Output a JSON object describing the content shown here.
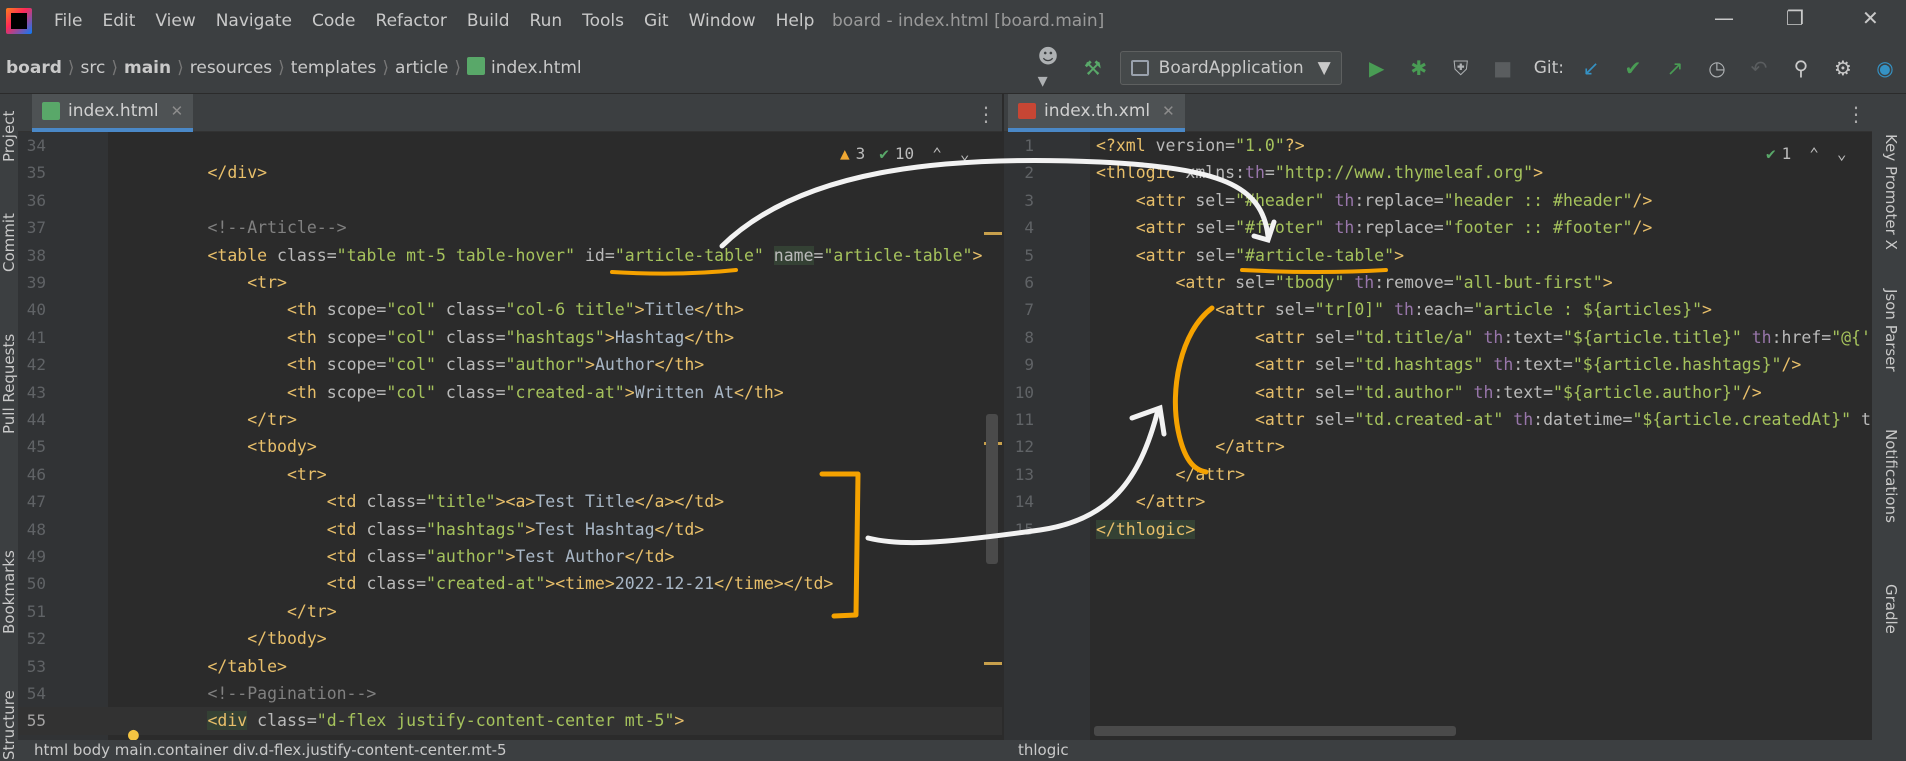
{
  "menu": {
    "items": [
      "File",
      "Edit",
      "View",
      "Navigate",
      "Code",
      "Refactor",
      "Build",
      "Run",
      "Tools",
      "Git",
      "Window",
      "Help"
    ],
    "window_title": "board - index.html [board.main]"
  },
  "breadcrumbs": [
    "board",
    "src",
    "main",
    "resources",
    "templates",
    "article",
    "index.html"
  ],
  "toolbar": {
    "run_config": "BoardApplication",
    "git_label": "Git:"
  },
  "side_tools": {
    "left": [
      "Project",
      "Commit",
      "Pull Requests",
      "Bookmarks",
      "Structure"
    ],
    "right": [
      "Key Promoter X",
      "Json Parser",
      "Notifications",
      "Gradle"
    ]
  },
  "left_editor": {
    "tab": "index.html",
    "warnings": "3",
    "checks": "10",
    "lines": [
      {
        "n": "34",
        "html": ""
      },
      {
        "n": "35",
        "html": "        <span class='t'>&lt;/div&gt;</span>"
      },
      {
        "n": "36",
        "html": ""
      },
      {
        "n": "37",
        "html": "        <span class='c'>&lt;!--Article--&gt;</span>"
      },
      {
        "n": "38",
        "html": "        <span class='t'>&lt;table </span><span class='a'>class=</span><span class='v'>\"table mt-5 table-hover\"</span><span class='a'> id=</span><span class='v'>\"article-table\"</span><span class='a'> <span class='hl'>name</span>=</span><span class='v'>\"article-table\"</span><span class='t'>&gt;</span>"
      },
      {
        "n": "39",
        "html": "            <span class='t'>&lt;tr&gt;</span>"
      },
      {
        "n": "40",
        "html": "                <span class='t'>&lt;th </span><span class='a'>scope=</span><span class='v'>\"col\"</span><span class='a'> class=</span><span class='v'>\"col-6 title\"</span><span class='t'>&gt;</span><span class='x'>Title</span><span class='t'>&lt;/th&gt;</span>"
      },
      {
        "n": "41",
        "html": "                <span class='t'>&lt;th </span><span class='a'>scope=</span><span class='v'>\"col\"</span><span class='a'> class=</span><span class='v'>\"hashtags\"</span><span class='t'>&gt;</span><span class='x'>Hashtag</span><span class='t'>&lt;/th&gt;</span>"
      },
      {
        "n": "42",
        "html": "                <span class='t'>&lt;th </span><span class='a'>scope=</span><span class='v'>\"col\"</span><span class='a'> class=</span><span class='v'>\"author\"</span><span class='t'>&gt;</span><span class='x'>Author</span><span class='t'>&lt;/th&gt;</span>"
      },
      {
        "n": "43",
        "html": "                <span class='t'>&lt;th </span><span class='a'>scope=</span><span class='v'>\"col\"</span><span class='a'> class=</span><span class='v'>\"created-at\"</span><span class='t'>&gt;</span><span class='x'>Written At</span><span class='t'>&lt;/th&gt;</span>"
      },
      {
        "n": "44",
        "html": "            <span class='t'>&lt;/tr&gt;</span>"
      },
      {
        "n": "45",
        "html": "            <span class='t'>&lt;tbody&gt;</span>"
      },
      {
        "n": "46",
        "html": "                <span class='t'>&lt;tr&gt;</span>"
      },
      {
        "n": "47",
        "html": "                    <span class='t'>&lt;td </span><span class='a'>class=</span><span class='v'>\"title\"</span><span class='t'>&gt;&lt;a&gt;</span><span class='x'>Test Title</span><span class='t'>&lt;/a&gt;&lt;/td&gt;</span>"
      },
      {
        "n": "48",
        "html": "                    <span class='t'>&lt;td </span><span class='a'>class=</span><span class='v'>\"hashtags\"</span><span class='t'>&gt;</span><span class='x'>Test Hashtag</span><span class='t'>&lt;/td&gt;</span>"
      },
      {
        "n": "49",
        "html": "                    <span class='t'>&lt;td </span><span class='a'>class=</span><span class='v'>\"author\"</span><span class='t'>&gt;</span><span class='x'>Test Author</span><span class='t'>&lt;/td&gt;</span>"
      },
      {
        "n": "50",
        "html": "                    <span class='t'>&lt;td </span><span class='a'>class=</span><span class='v'>\"created-at\"</span><span class='t'>&gt;&lt;time&gt;</span><span class='x'>2022-12-21</span><span class='t'>&lt;/time&gt;&lt;/td&gt;</span>"
      },
      {
        "n": "51",
        "html": "                <span class='t'>&lt;/tr&gt;</span>"
      },
      {
        "n": "52",
        "html": "            <span class='t'>&lt;/tbody&gt;</span>"
      },
      {
        "n": "53",
        "html": "        <span class='t'>&lt;/table&gt;</span>"
      },
      {
        "n": "54",
        "html": "        <span class='c'>&lt;!--Pagination--&gt;</span>"
      },
      {
        "n": "55",
        "html": "        <span class='t'><span class='hl'>&lt;div</span> </span><span class='a'>class=</span><span class='v'>\"d-flex justify-content-center mt-5\"</span><span class='t'>&gt;</span>"
      }
    ],
    "status_path": "html  body  main.container  div.d-flex.justify-content-center.mt-5"
  },
  "right_editor": {
    "tab": "index.th.xml",
    "checks": "1",
    "lines": [
      {
        "n": "1",
        "html": "<span class='t'>&lt;?xml </span><span class='a'>version=</span><span class='v'>\"1.0\"</span><span class='t'>?&gt;</span>"
      },
      {
        "n": "2",
        "html": "<span class='t'>&lt;thlogic </span><span class='a'>xmlns:</span><span class='n'>th</span><span class='a'>=</span><span class='v'>\"http://www.thymeleaf.org\"</span><span class='t'>&gt;</span>"
      },
      {
        "n": "3",
        "html": "    <span class='t'>&lt;attr </span><span class='a'>sel=</span><span class='v'>\"#header\"</span><span class='a'> </span><span class='n'>th</span><span class='a'>:replace=</span><span class='v'>\"header :: #header\"</span><span class='t'>/&gt;</span>"
      },
      {
        "n": "4",
        "html": "    <span class='t'>&lt;attr </span><span class='a'>sel=</span><span class='v'>\"#footer\"</span><span class='a'> </span><span class='n'>th</span><span class='a'>:replace=</span><span class='v'>\"footer :: #footer\"</span><span class='t'>/&gt;</span>"
      },
      {
        "n": "5",
        "html": "    <span class='t'>&lt;attr </span><span class='a'>sel=</span><span class='v'>\"#article-table\"</span><span class='t'>&gt;</span>"
      },
      {
        "n": "6",
        "html": "        <span class='t'>&lt;attr </span><span class='a'>sel=</span><span class='v'>\"tbody\"</span><span class='a'> </span><span class='n'>th</span><span class='a'>:remove=</span><span class='v'>\"all-but-first\"</span><span class='t'>&gt;</span>"
      },
      {
        "n": "7",
        "html": "            <span class='t'>&lt;attr </span><span class='a'>sel=</span><span class='v'>\"tr[0]\"</span><span class='a'> </span><span class='n'>th</span><span class='a'>:each=</span><span class='v'>\"article : ${articles}\"</span><span class='t'>&gt;</span>"
      },
      {
        "n": "8",
        "html": "                <span class='t'>&lt;attr </span><span class='a'>sel=</span><span class='v'>\"td.title/a\"</span><span class='a'> </span><span class='n'>th</span><span class='a'>:text=</span><span class='v'>\"${article.title}\"</span><span class='a'> </span><span class='n'>th</span><span class='a'>:href=</span><span class='v'>\"@{'</span>"
      },
      {
        "n": "9",
        "html": "                <span class='t'>&lt;attr </span><span class='a'>sel=</span><span class='v'>\"td.hashtags\"</span><span class='a'> </span><span class='n'>th</span><span class='a'>:text=</span><span class='v'>\"${article.hashtags}\"</span><span class='t'>/&gt;</span>"
      },
      {
        "n": "10",
        "html": "                <span class='t'>&lt;attr </span><span class='a'>sel=</span><span class='v'>\"td.author\"</span><span class='a'> </span><span class='n'>th</span><span class='a'>:text=</span><span class='v'>\"${article.author}\"</span><span class='t'>/&gt;</span>"
      },
      {
        "n": "11",
        "html": "                <span class='t'>&lt;attr </span><span class='a'>sel=</span><span class='v'>\"td.created-at\"</span><span class='a'> </span><span class='n'>th</span><span class='a'>:datetime=</span><span class='v'>\"${article.createdAt}\"</span><span class='a'> t</span>"
      },
      {
        "n": "12",
        "html": "            <span class='t'>&lt;/attr&gt;</span>"
      },
      {
        "n": "13",
        "html": "        <span class='t'>&lt;/attr&gt;</span>"
      },
      {
        "n": "14",
        "html": "    <span class='t'>&lt;/attr&gt;</span>"
      },
      {
        "n": "15",
        "html": "<span class='t'><span class='hl'>&lt;/thlogic&gt;</span></span>"
      }
    ],
    "status_path": "thlogic"
  },
  "colors": {
    "annotation_white": "#f2f2f2",
    "annotation_orange": "#f5a200",
    "tab_underline": "#4a88c7"
  }
}
